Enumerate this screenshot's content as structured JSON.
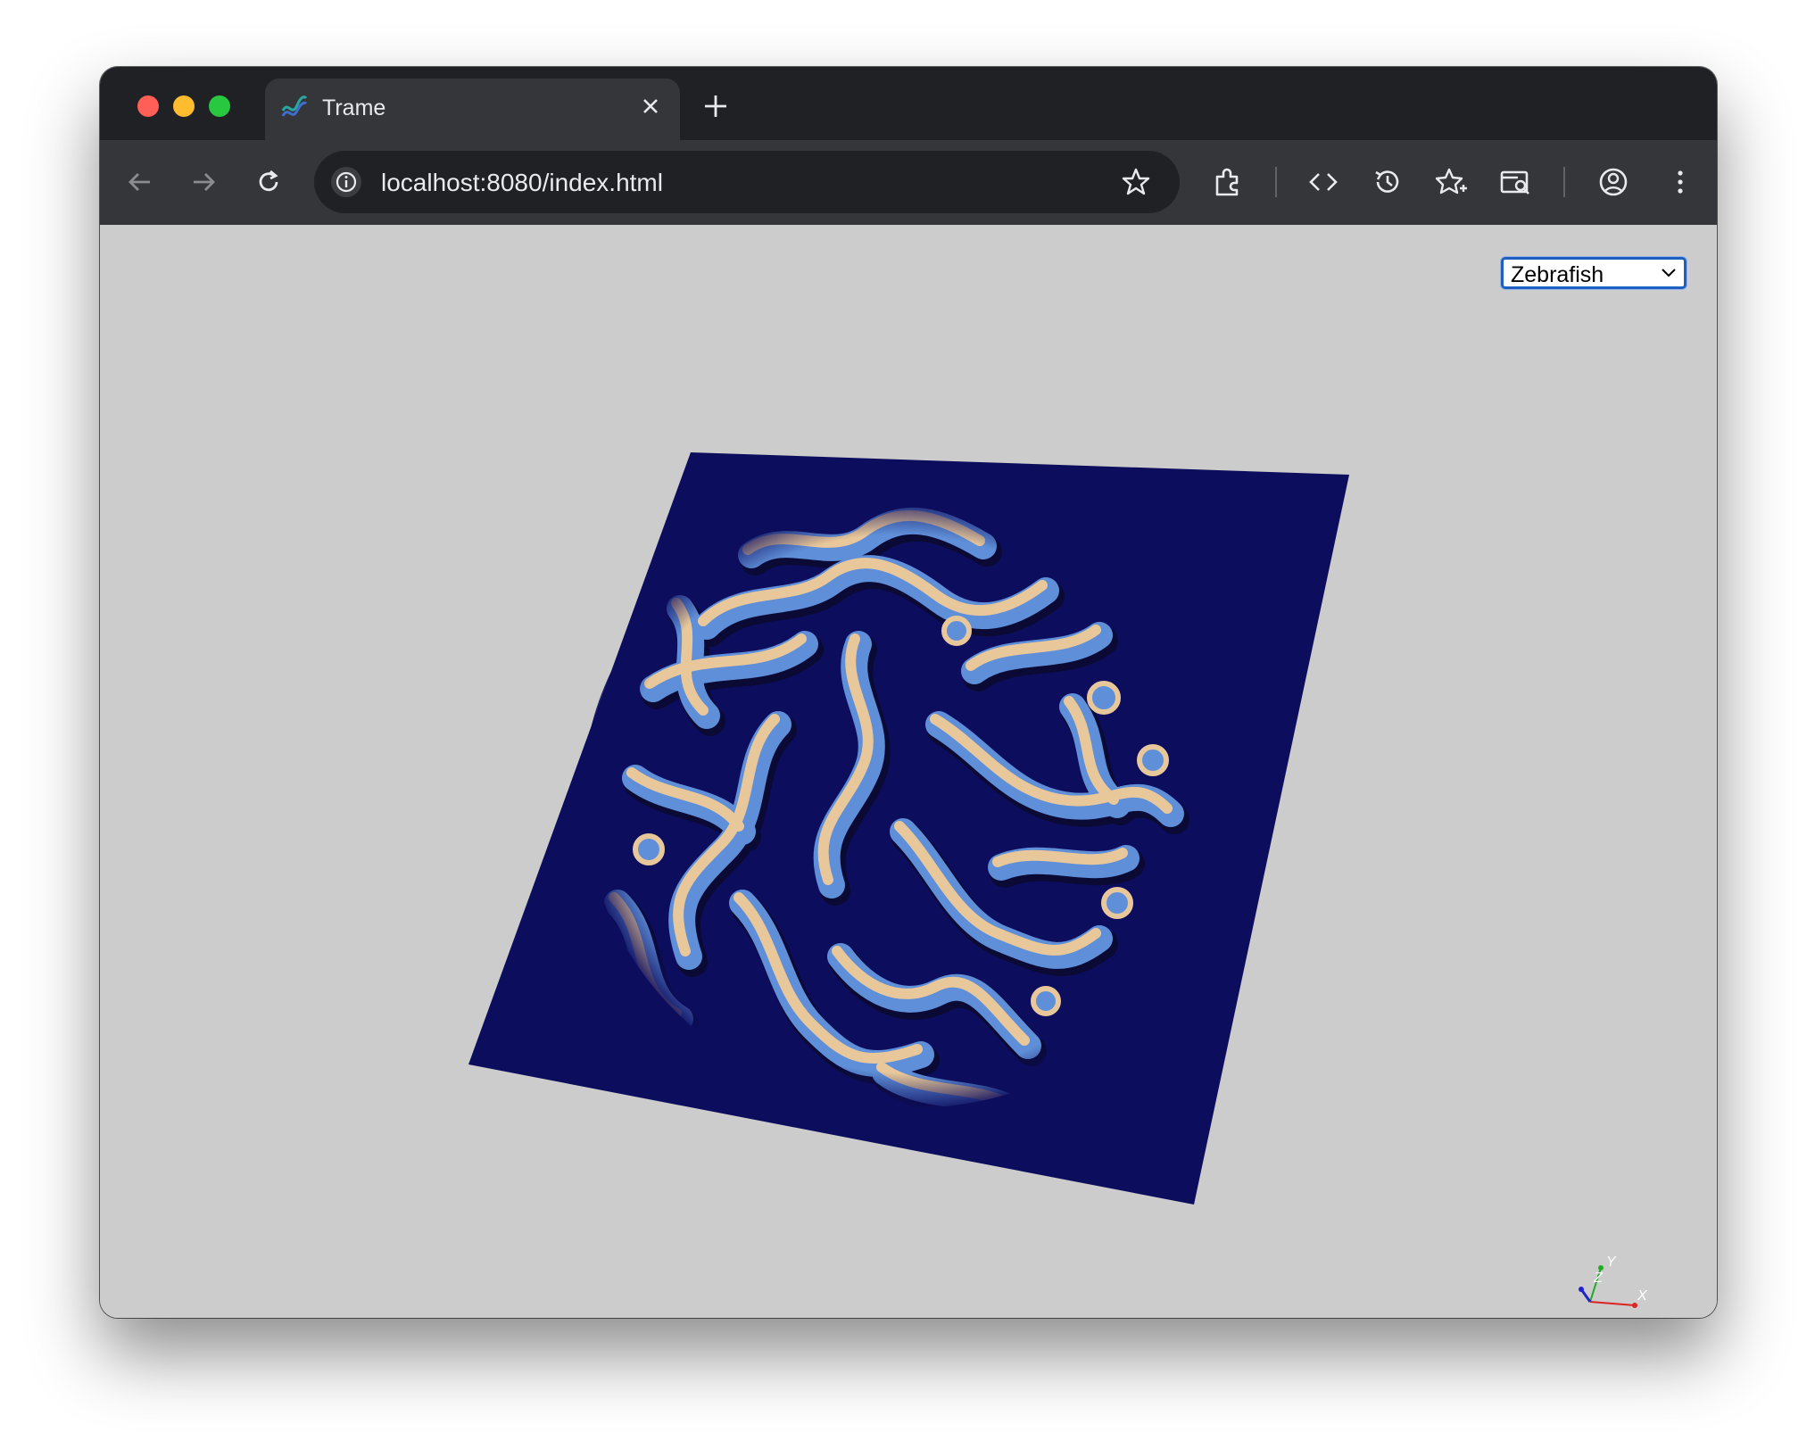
{
  "browser": {
    "tab": {
      "title": "Trame",
      "icon": "trame-logo-icon"
    },
    "address_bar": {
      "url": "localhost:8080/index.html"
    },
    "toolbar_icons": [
      "back-icon",
      "forward-icon",
      "reload-icon",
      "site-info-icon",
      "bookmark-star-icon",
      "extensions-icon",
      "devtools-icon",
      "history-icon",
      "bookmarks-icon",
      "tab-search-icon",
      "profile-icon",
      "menu-icon"
    ]
  },
  "app": {
    "preset_select": {
      "value": "Zebrafish",
      "options": [
        "Zebrafish"
      ]
    },
    "visualization": {
      "description_colors": {
        "plane": "#0d0d5e",
        "ridge_light": "#e8c89a",
        "ridge_mid": "#5f8fd8"
      }
    },
    "orientation_axes": {
      "x_label": "X",
      "y_label": "Y",
      "z_label": "Z"
    }
  }
}
